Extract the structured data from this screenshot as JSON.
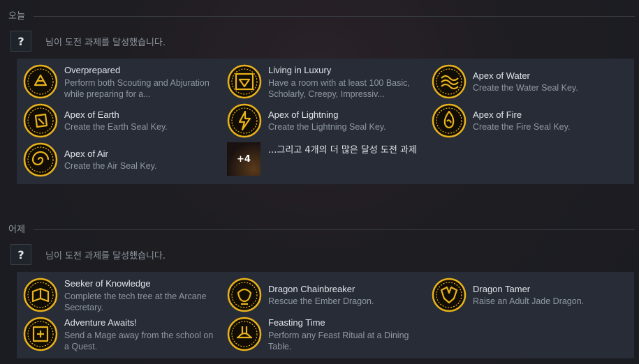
{
  "days": [
    {
      "label": "오늘",
      "status": "님이 도전 과제를 달성했습니다.",
      "avatar": "?",
      "achievements": [
        {
          "title": "Overprepared",
          "desc": "Perform both Scouting and Abjuration while preparing for a...",
          "icon": "owl-seal-icon"
        },
        {
          "title": "Living in Luxury",
          "desc": "Have a room with at least 100 Basic, Scholarly, Creepy, Impressiv...",
          "icon": "gem-frame-icon"
        },
        {
          "title": "Apex of Water",
          "desc": "Create the Water Seal Key.",
          "icon": "water-seal-icon"
        },
        {
          "title": "Apex of Earth",
          "desc": "Create the Earth Seal Key.",
          "icon": "earth-seal-icon"
        },
        {
          "title": "Apex of Lightning",
          "desc": "Create the Lightning Seal Key.",
          "icon": "lightning-seal-icon"
        },
        {
          "title": "Apex of Fire",
          "desc": "Create the Fire Seal Key.",
          "icon": "fire-seal-icon"
        },
        {
          "title": "Apex of Air",
          "desc": "Create the Air Seal Key.",
          "icon": "air-seal-icon"
        }
      ],
      "more": {
        "count": "+4",
        "text": "...그리고 4개의 더 많은 달성 도전 과제"
      }
    },
    {
      "label": "어제",
      "status": "님이 도전 과제를 달성했습니다.",
      "avatar": "?",
      "achievements": [
        {
          "title": "Seeker of Knowledge",
          "desc": "Complete the tech tree at the Arcane Secretary.",
          "icon": "book-seal-icon"
        },
        {
          "title": "Dragon Chainbreaker",
          "desc": "Rescue the Ember Dragon.",
          "icon": "dragon-chain-icon"
        },
        {
          "title": "Dragon Tamer",
          "desc": "Raise an Adult Jade Dragon.",
          "icon": "dragon-head-icon"
        },
        {
          "title": "Adventure Awaits!",
          "desc": "Send a Mage away from the school on a Quest.",
          "icon": "adventure-icon"
        },
        {
          "title": "Feasting Time",
          "desc": "Perform any Feast Ritual at a Dining Table.",
          "icon": "feast-icon"
        }
      ]
    }
  ],
  "colors": {
    "gold": "#e8b21c",
    "panel": "#282c36",
    "title": "#dfe6ec",
    "desc": "#8f98a0"
  }
}
